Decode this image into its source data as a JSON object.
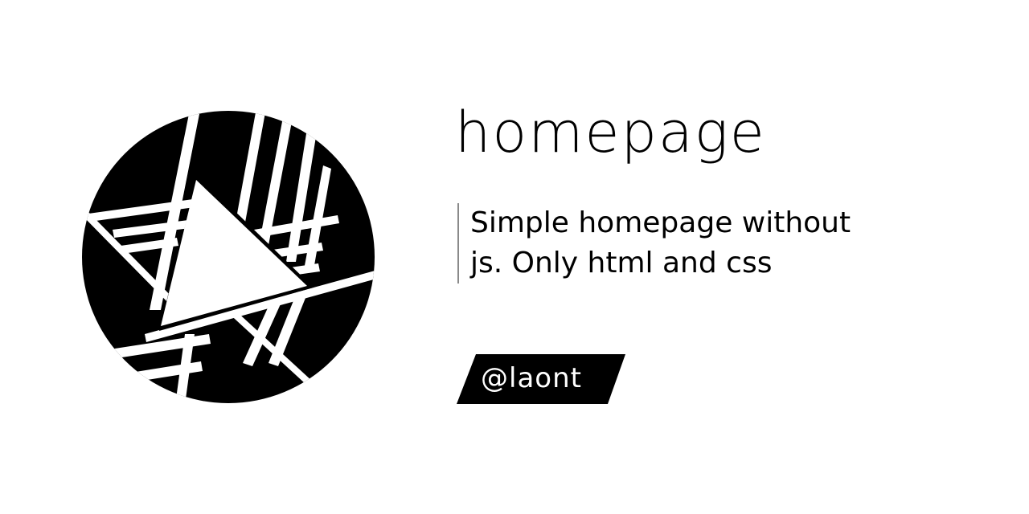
{
  "title": "homepage",
  "description": "Simple homepage without js. Only html and css",
  "handle": "@laont",
  "logo_icon": "circle-triangle-logo-icon",
  "colors": {
    "background": "#ffffff",
    "foreground": "#000000",
    "accent_bar": "#8a8a8a"
  }
}
